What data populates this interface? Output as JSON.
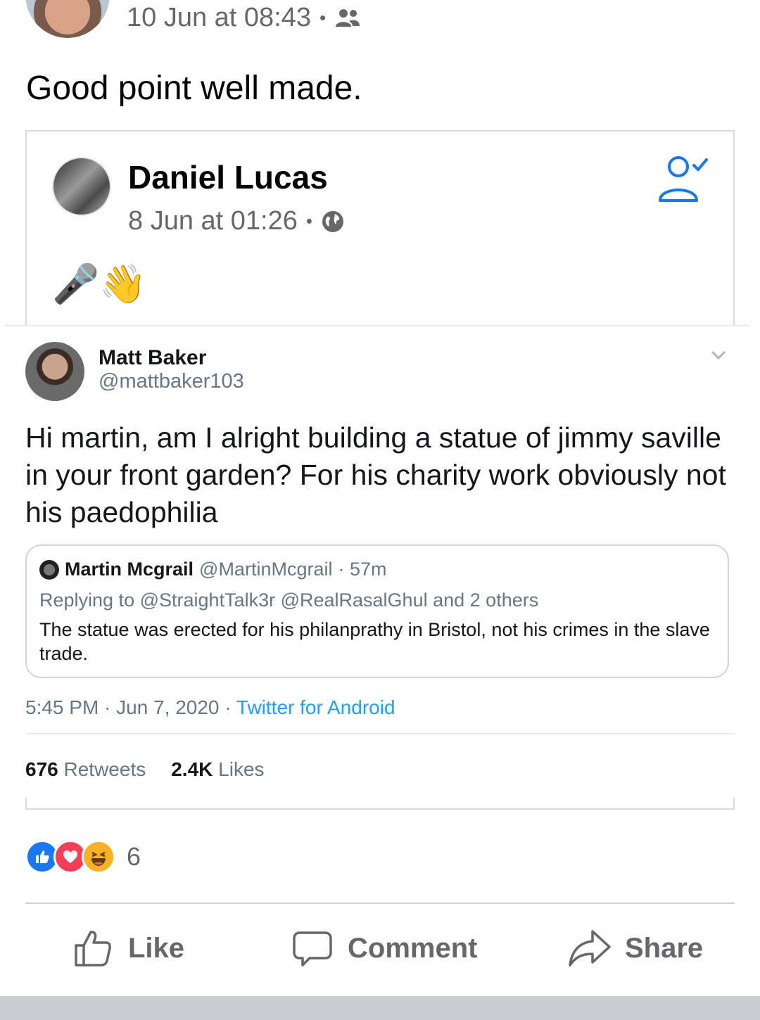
{
  "post": {
    "timestamp": "10 Jun at 08:43",
    "audience_icon": "friends-icon",
    "text": "Good point well made."
  },
  "shared_post": {
    "author": "Daniel Lucas",
    "timestamp": "8 Jun at 01:26",
    "audience_icon": "globe-icon",
    "emojis": "🎤👋"
  },
  "tweet": {
    "name": "Matt Baker",
    "handle": "@mattbaker103",
    "text": "Hi martin, am I alright building a statue of jimmy saville in your front garden? For his charity work obviously not his paedophilia",
    "quote": {
      "name": "Martin Mcgrail",
      "handle": "@MartinMcgrail",
      "age": "· 57m",
      "replying_prefix": "Replying to",
      "replying_to": "@StraightTalk3r @RealRasalGhul",
      "replying_suffix": "and 2 others",
      "text": "The statue was erected for his philanprathy in Bristol, not his crimes in the slave trade."
    },
    "time": "5:45 PM · Jun 7, 2020 ·",
    "source": "Twitter for Android",
    "retweets_count": "676",
    "retweets_label": "Retweets",
    "likes_count": "2.4K",
    "likes_label": "Likes"
  },
  "reactions": {
    "count": "6"
  },
  "actions": {
    "like": "Like",
    "comment": "Comment",
    "share": "Share"
  },
  "colors": {
    "facebook_blue": "#1877f2",
    "twitter_blue": "#1da1f2",
    "secondary_text": "#65676b"
  }
}
